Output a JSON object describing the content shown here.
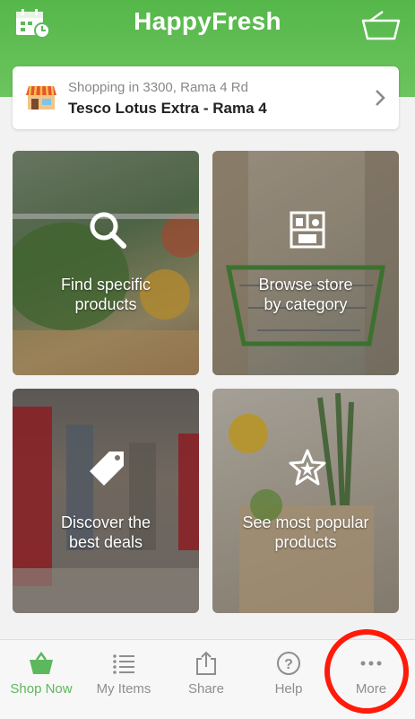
{
  "header": {
    "title": "HappyFresh",
    "left_icon": "calendar-clock-icon",
    "right_icon": "basket-icon",
    "color": "#5cb85c"
  },
  "store": {
    "subtitle": "Shopping in 3300, Rama 4 Rd",
    "name": "Tesco Lotus Extra - Rama 4",
    "icon": "storefront-icon"
  },
  "tiles": [
    {
      "line1": "Find specific",
      "line2": "products",
      "icon": "search-icon"
    },
    {
      "line1": "Browse store",
      "line2": "by category",
      "icon": "store-shelf-icon"
    },
    {
      "line1": "Discover the",
      "line2": "best deals",
      "icon": "tag-icon"
    },
    {
      "line1": "See most popular",
      "line2": "products",
      "icon": "star-icon"
    }
  ],
  "tabs": [
    {
      "label": "Shop Now",
      "icon": "basket-icon",
      "active": true
    },
    {
      "label": "My Items",
      "icon": "list-icon",
      "active": false
    },
    {
      "label": "Share",
      "icon": "share-icon",
      "active": false
    },
    {
      "label": "Help",
      "icon": "help-icon",
      "active": false
    },
    {
      "label": "More",
      "icon": "more-icon",
      "active": false
    }
  ],
  "colors": {
    "accent": "#5cb85c",
    "highlight_ring": "#ff1a0a"
  }
}
